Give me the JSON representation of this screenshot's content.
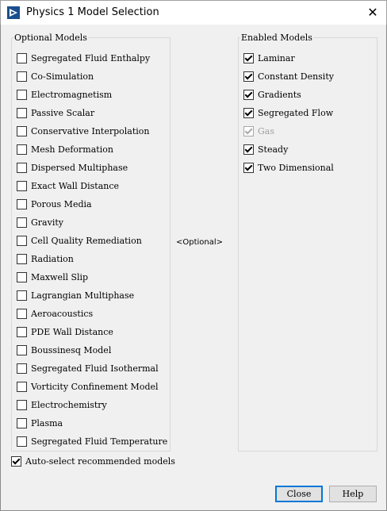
{
  "window": {
    "title": "Physics 1 Model Selection",
    "close_glyph": "✕",
    "icon": "app-logo-icon"
  },
  "optional": {
    "title": "Optional Models",
    "items": [
      {
        "label": "Segregated Fluid Enthalpy",
        "checked": false
      },
      {
        "label": "Co-Simulation",
        "checked": false
      },
      {
        "label": "Electromagnetism",
        "checked": false
      },
      {
        "label": "Passive Scalar",
        "checked": false
      },
      {
        "label": "Conservative Interpolation",
        "checked": false
      },
      {
        "label": "Mesh Deformation",
        "checked": false
      },
      {
        "label": "Dispersed Multiphase",
        "checked": false
      },
      {
        "label": "Exact Wall Distance",
        "checked": false
      },
      {
        "label": "Porous Media",
        "checked": false
      },
      {
        "label": "Gravity",
        "checked": false
      },
      {
        "label": "Cell Quality Remediation",
        "checked": false
      },
      {
        "label": "Radiation",
        "checked": false
      },
      {
        "label": "Maxwell Slip",
        "checked": false
      },
      {
        "label": "Lagrangian Multiphase",
        "checked": false
      },
      {
        "label": "Aeroacoustics",
        "checked": false
      },
      {
        "label": "PDE Wall Distance",
        "checked": false
      },
      {
        "label": "Boussinesq Model",
        "checked": false
      },
      {
        "label": "Segregated Fluid Isothermal",
        "checked": false
      },
      {
        "label": "Vorticity Confinement Model",
        "checked": false
      },
      {
        "label": "Electrochemistry",
        "checked": false
      },
      {
        "label": "Plasma",
        "checked": false
      },
      {
        "label": "Segregated Fluid Temperature",
        "checked": false
      }
    ]
  },
  "center_label": "<Optional>",
  "enabled": {
    "title": "Enabled Models",
    "items": [
      {
        "label": "Laminar",
        "checked": true,
        "disabled": false
      },
      {
        "label": "Constant Density",
        "checked": true,
        "disabled": false
      },
      {
        "label": "Gradients",
        "checked": true,
        "disabled": false
      },
      {
        "label": "Segregated Flow",
        "checked": true,
        "disabled": false
      },
      {
        "label": "Gas",
        "checked": true,
        "disabled": true
      },
      {
        "label": "Steady",
        "checked": true,
        "disabled": false
      },
      {
        "label": "Two Dimensional",
        "checked": true,
        "disabled": false
      }
    ]
  },
  "auto_select": {
    "label": "Auto-select recommended models",
    "checked": true
  },
  "buttons": {
    "close": "Close",
    "help": "Help"
  }
}
